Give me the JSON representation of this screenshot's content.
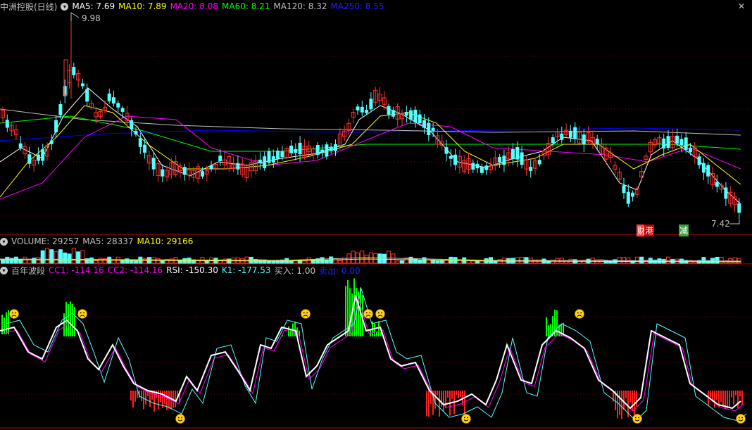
{
  "main_header": {
    "stock": "中洲控股(日线)",
    "ma5": "MA5: 7.69",
    "ma10": "MA10: 7.89",
    "ma20": "MA20: 8.08",
    "ma60": "MA60: 8.21",
    "ma120": "MA120: 8.32",
    "ma250": "MA250: 8.55"
  },
  "price_labels": {
    "high": "9.98",
    "low": "7.42"
  },
  "event_tags": {
    "tag1": "财",
    "tag2": "港",
    "tag3": "减"
  },
  "volume_header": {
    "volume": "VOLUME: 29257",
    "ma5": "MA5: 28337",
    "ma10": "MA10: 29166"
  },
  "indicator_header": {
    "name": "百年波段",
    "cc1": "CC1: -114.16",
    "cc2": "CC2: -114.16",
    "rsi": "RSI: -150.30",
    "k1": "K1: -177.53",
    "buy": "买入: 1.00",
    "sell": "卖出: 0.00"
  },
  "icons": {
    "collapse": "circle-down-icon",
    "close": "close-icon",
    "sad": "sad-face-icon",
    "happy": "happy-face-icon"
  },
  "colors": {
    "ma5": "#ffffff",
    "ma10": "#ffff00",
    "ma20": "#ff00ff",
    "ma60": "#00ff00",
    "ma120": "#c0c0c0",
    "ma250": "#0000ff",
    "up": "#ff3232",
    "down": "#54ffff",
    "grid": "#800000",
    "cc": "#ff00ff",
    "rsi": "#ffffff",
    "k1": "#54ffff"
  }
}
